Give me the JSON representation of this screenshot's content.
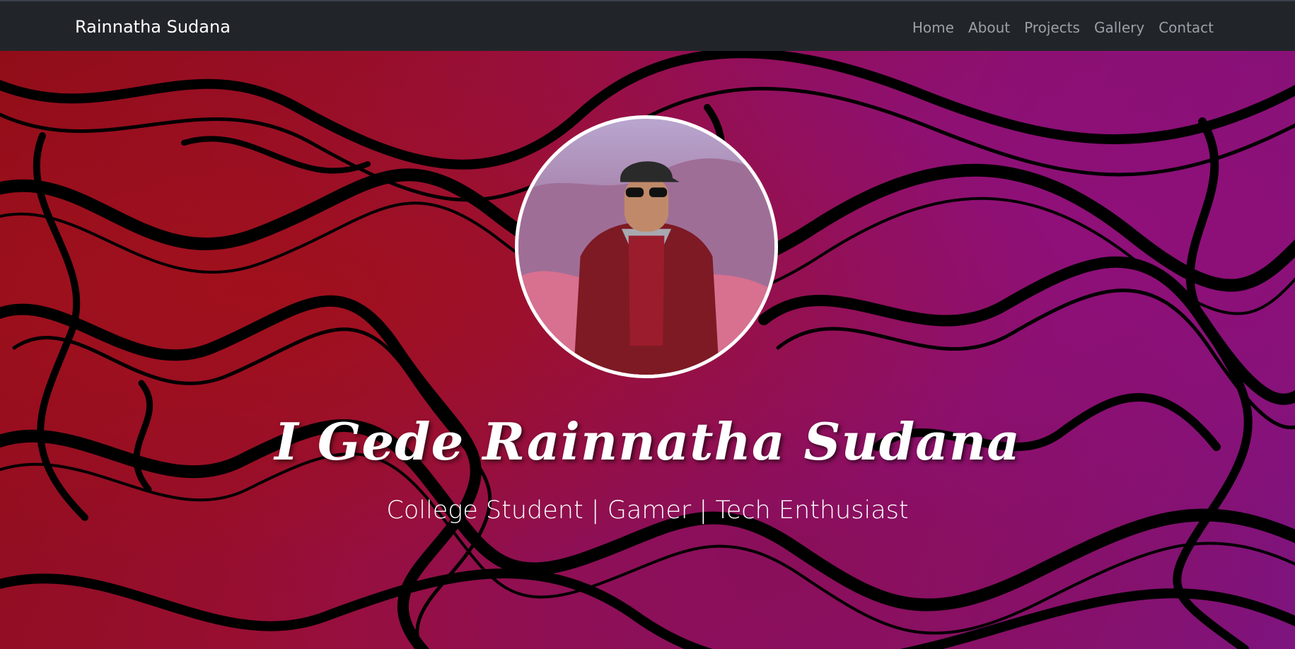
{
  "navbar": {
    "brand": "Rainnatha Sudana",
    "links": [
      "Home",
      "About",
      "Projects",
      "Gallery",
      "Contact"
    ]
  },
  "hero": {
    "name": "I Gede Rainnatha Sudana",
    "tagline": "College Student | Gamer | Tech Enthusiast"
  },
  "colors": {
    "navbar_bg": "#212529",
    "brand_text": "#ffffff",
    "nav_link": "#9aa0a6",
    "hero_red": "#9a0f1c",
    "hero_magenta": "#8a1070",
    "swirl_black": "#000000"
  }
}
